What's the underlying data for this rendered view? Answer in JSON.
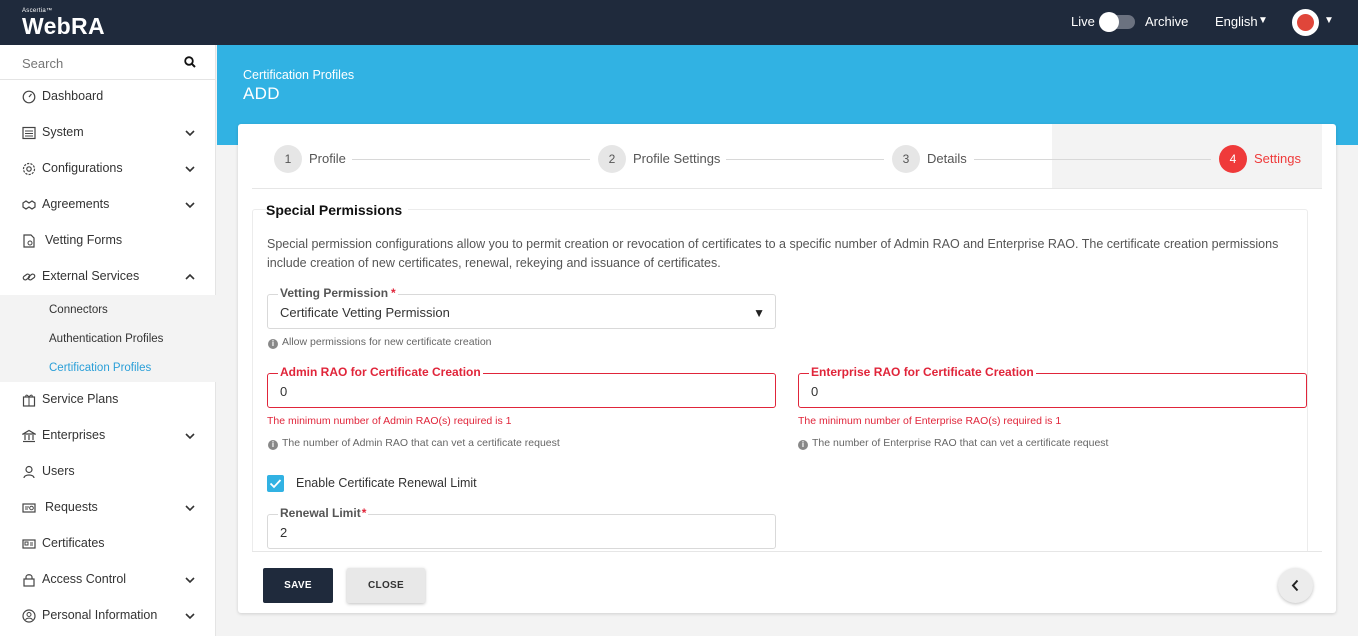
{
  "header": {
    "logo_brand": "Ascertia™",
    "logo": "WebRA",
    "live_label": "Live",
    "archive_label": "Archive",
    "language": "English"
  },
  "sidebar": {
    "search_placeholder": "Search",
    "items": [
      {
        "label": "Dashboard",
        "icon": "dashboard-icon"
      },
      {
        "label": "System",
        "icon": "system-icon"
      },
      {
        "label": "Configurations",
        "icon": "gear-icon"
      },
      {
        "label": "Agreements",
        "icon": "handshake-icon"
      },
      {
        "label": "Vetting Forms",
        "icon": "form-icon"
      },
      {
        "label": "External Services",
        "icon": "link-icon"
      },
      {
        "label": "Service Plans",
        "icon": "gift-icon"
      },
      {
        "label": "Enterprises",
        "icon": "bank-icon"
      },
      {
        "label": "Users",
        "icon": "user-icon"
      },
      {
        "label": "Requests",
        "icon": "request-icon"
      },
      {
        "label": "Certificates",
        "icon": "certificate-icon"
      },
      {
        "label": "Access Control",
        "icon": "lock-icon"
      },
      {
        "label": "Personal Information",
        "icon": "person-circle-icon"
      }
    ],
    "submenu": [
      "Connectors",
      "Authentication Profiles",
      "Certification Profiles"
    ],
    "active_submenu": "Certification Profiles"
  },
  "page": {
    "breadcrumb": "Certification Profiles",
    "title": "ADD"
  },
  "stepper": {
    "steps": [
      {
        "number": "1",
        "label": "Profile"
      },
      {
        "number": "2",
        "label": "Profile Settings"
      },
      {
        "number": "3",
        "label": "Details"
      },
      {
        "number": "4",
        "label": "Settings"
      }
    ],
    "active_step": 4
  },
  "special_permissions": {
    "title": "Special Permissions",
    "description": "Special permission configurations allow you to permit creation or revocation of certificates to a specific number of Admin RAO and Enterprise RAO. The certificate creation permissions include creation of new certificates, renewal, rekeying and issuance of certificates.",
    "vetting_permission": {
      "label": "Vetting Permission",
      "required_mark": "*",
      "value": "Certificate Vetting Permission",
      "hint": "Allow permissions for new certificate creation"
    },
    "admin_rao": {
      "label": "Admin RAO for Certificate Creation",
      "value": "0",
      "error": "The minimum number of Admin RAO(s) required is 1",
      "hint": "The number of Admin RAO that can vet a certificate request"
    },
    "enterprise_rao": {
      "label": "Enterprise RAO for Certificate Creation",
      "value": "0",
      "error": "The minimum number of Enterprise RAO(s) required is 1",
      "hint": "The number of Enterprise RAO that can vet a certificate request"
    },
    "renewal_checkbox": {
      "label": "Enable Certificate Renewal Limit",
      "checked": true
    },
    "renewal_limit": {
      "label": "Renewal Limit",
      "required_mark": "*",
      "value": "2"
    }
  },
  "footer": {
    "save_label": "SAVE",
    "close_label": "CLOSE"
  },
  "colors": {
    "topbar": "#1f2a3c",
    "accent": "#31b2e3",
    "error": "#e0253a",
    "active_step": "#ef3a3a"
  }
}
